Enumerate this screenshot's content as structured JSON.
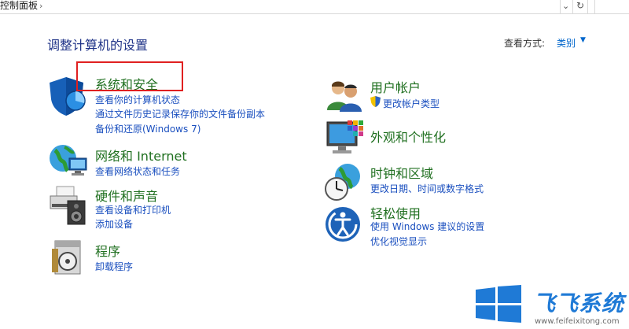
{
  "address_bar": {
    "breadcrumb": "控制面板",
    "separator": "›",
    "dropdown_glyph": "⌄",
    "refresh_glyph": "↻"
  },
  "header": {
    "title": "调整计算机的设置",
    "view_by_label": "查看方式:",
    "view_by_value": "类别",
    "view_by_arrow": "▼"
  },
  "categories": [
    {
      "title": "系统和安全",
      "icon": "shield-icon",
      "links": [
        "查看你的计算机状态",
        "通过文件历史记录保存你的文件备份副本",
        "备份和还原(Windows 7)"
      ]
    },
    {
      "title": "网络和 Internet",
      "icon": "network-globe-icon",
      "links": [
        "查看网络状态和任务"
      ]
    },
    {
      "title": "硬件和声音",
      "icon": "printer-speaker-icon",
      "links": [
        "查看设备和打印机",
        "添加设备"
      ]
    },
    {
      "title": "程序",
      "icon": "programs-icon",
      "links": [
        "卸载程序"
      ]
    },
    {
      "title": "用户帐户",
      "icon": "users-icon",
      "links": [
        "更改帐户类型"
      ]
    },
    {
      "title": "外观和个性化",
      "icon": "monitor-palette-icon",
      "links": []
    },
    {
      "title": "时钟和区域",
      "icon": "clock-globe-icon",
      "links": [
        "更改日期、时间或数字格式"
      ]
    },
    {
      "title": "轻松使用",
      "icon": "ease-of-access-icon",
      "links": [
        "使用 Windows 建议的设置",
        "优化视觉显示"
      ]
    }
  ],
  "watermark": {
    "brand": "飞飞系统",
    "url": "www.feifeixitong.com",
    "colors": {
      "primary": "#1f7ad6"
    }
  },
  "colors": {
    "category_title": "#207020",
    "link": "#1a4fbf",
    "page_title": "#1e3287",
    "highlight_box": "#e02020"
  }
}
